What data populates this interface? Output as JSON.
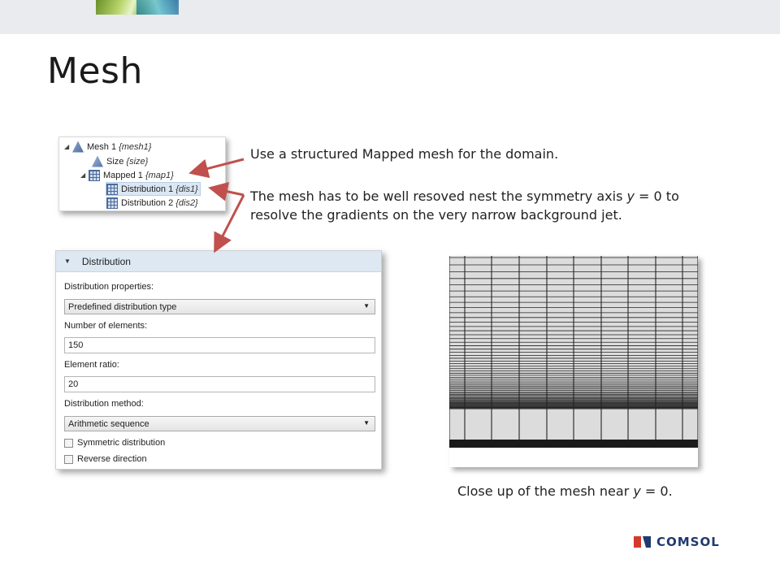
{
  "slide": {
    "title": "Mesh",
    "text1": "Use a structured Mapped mesh for the domain.",
    "text2_part1": "The mesh has to be well resoved nest the symmetry axis ",
    "text2_var": "y",
    "text2_part2": " = 0 to resolve the gradients on the very narrow background jet.",
    "caption_part1": "Close up of the mesh near ",
    "caption_var": "y",
    "caption_part2": " = 0.",
    "logo_text": "COMSOL"
  },
  "tree": {
    "items": [
      {
        "label": "Mesh 1",
        "tag": "{mesh1}",
        "icon": "mesh-icon"
      },
      {
        "label": "Size",
        "tag": "{size}",
        "icon": "size-icon"
      },
      {
        "label": "Mapped 1",
        "tag": "{map1}",
        "icon": "mapped-icon"
      },
      {
        "label": "Distribution 1",
        "tag": "{dis1}",
        "icon": "distribution-icon"
      },
      {
        "label": "Distribution 2",
        "tag": "{dis2}",
        "icon": "distribution-icon"
      }
    ]
  },
  "panel": {
    "section_title": "Distribution",
    "distribution_properties_label": "Distribution properties:",
    "distribution_properties_value": "Predefined distribution type",
    "number_of_elements_label": "Number of elements:",
    "number_of_elements_value": "150",
    "element_ratio_label": "Element ratio:",
    "element_ratio_value": "20",
    "distribution_method_label": "Distribution method:",
    "distribution_method_value": "Arithmetic sequence",
    "symmetric_label": "Symmetric distribution",
    "symmetric_checked": false,
    "reverse_label": "Reverse direction",
    "reverse_checked": false
  },
  "colors": {
    "accent_arrow": "#c0504d",
    "logo_red": "#d33a2c",
    "logo_blue": "#1f3a6e"
  }
}
